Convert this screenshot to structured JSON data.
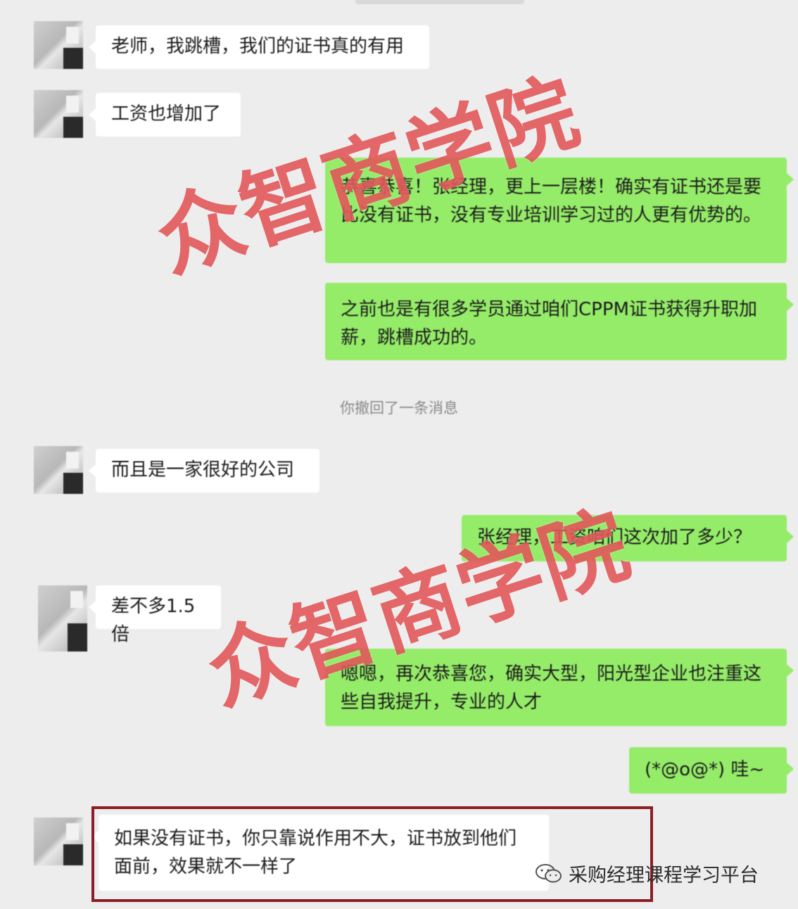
{
  "messages": [
    {
      "side": "in",
      "text": "老师，我跳槽，我们的证书真的有用"
    },
    {
      "side": "in",
      "text": "工资也增加了"
    },
    {
      "side": "out",
      "text": "恭喜恭喜！张经理，更上一层楼！确实有证书还是要比没有证书，没有专业培训学习过的人更有优势的。"
    },
    {
      "side": "out",
      "text": "之前也是有很多学员通过咱们CPPM证书获得升职加薪，跳槽成功的。"
    },
    {
      "side": "in",
      "text": "而且是一家很好的公司"
    },
    {
      "side": "out",
      "text": "张经理，工资咱们这次加了多少？"
    },
    {
      "side": "in",
      "text": "差不多1.5倍"
    },
    {
      "side": "out",
      "text": "嗯嗯，再次恭喜您，确实大型，阳光型企业也注重这些自我提升，专业的人才"
    },
    {
      "side": "out",
      "text": "(*@o@*) 哇~"
    },
    {
      "side": "in",
      "text": "如果没有证书，你只靠说作用不大，证书放到他们面前，效果就不一样了"
    }
  ],
  "system_notice": "你撤回了一条消息",
  "watermark": {
    "text": "众智商学院"
  },
  "source": {
    "label": "采购经理课程学习平台",
    "icon": "wechat-icon"
  },
  "colors": {
    "incoming": "#ffffff",
    "outgoing": "#95ec69",
    "background": "#ededed",
    "highlight": "#8c1f24",
    "watermark": "#e2585a"
  }
}
